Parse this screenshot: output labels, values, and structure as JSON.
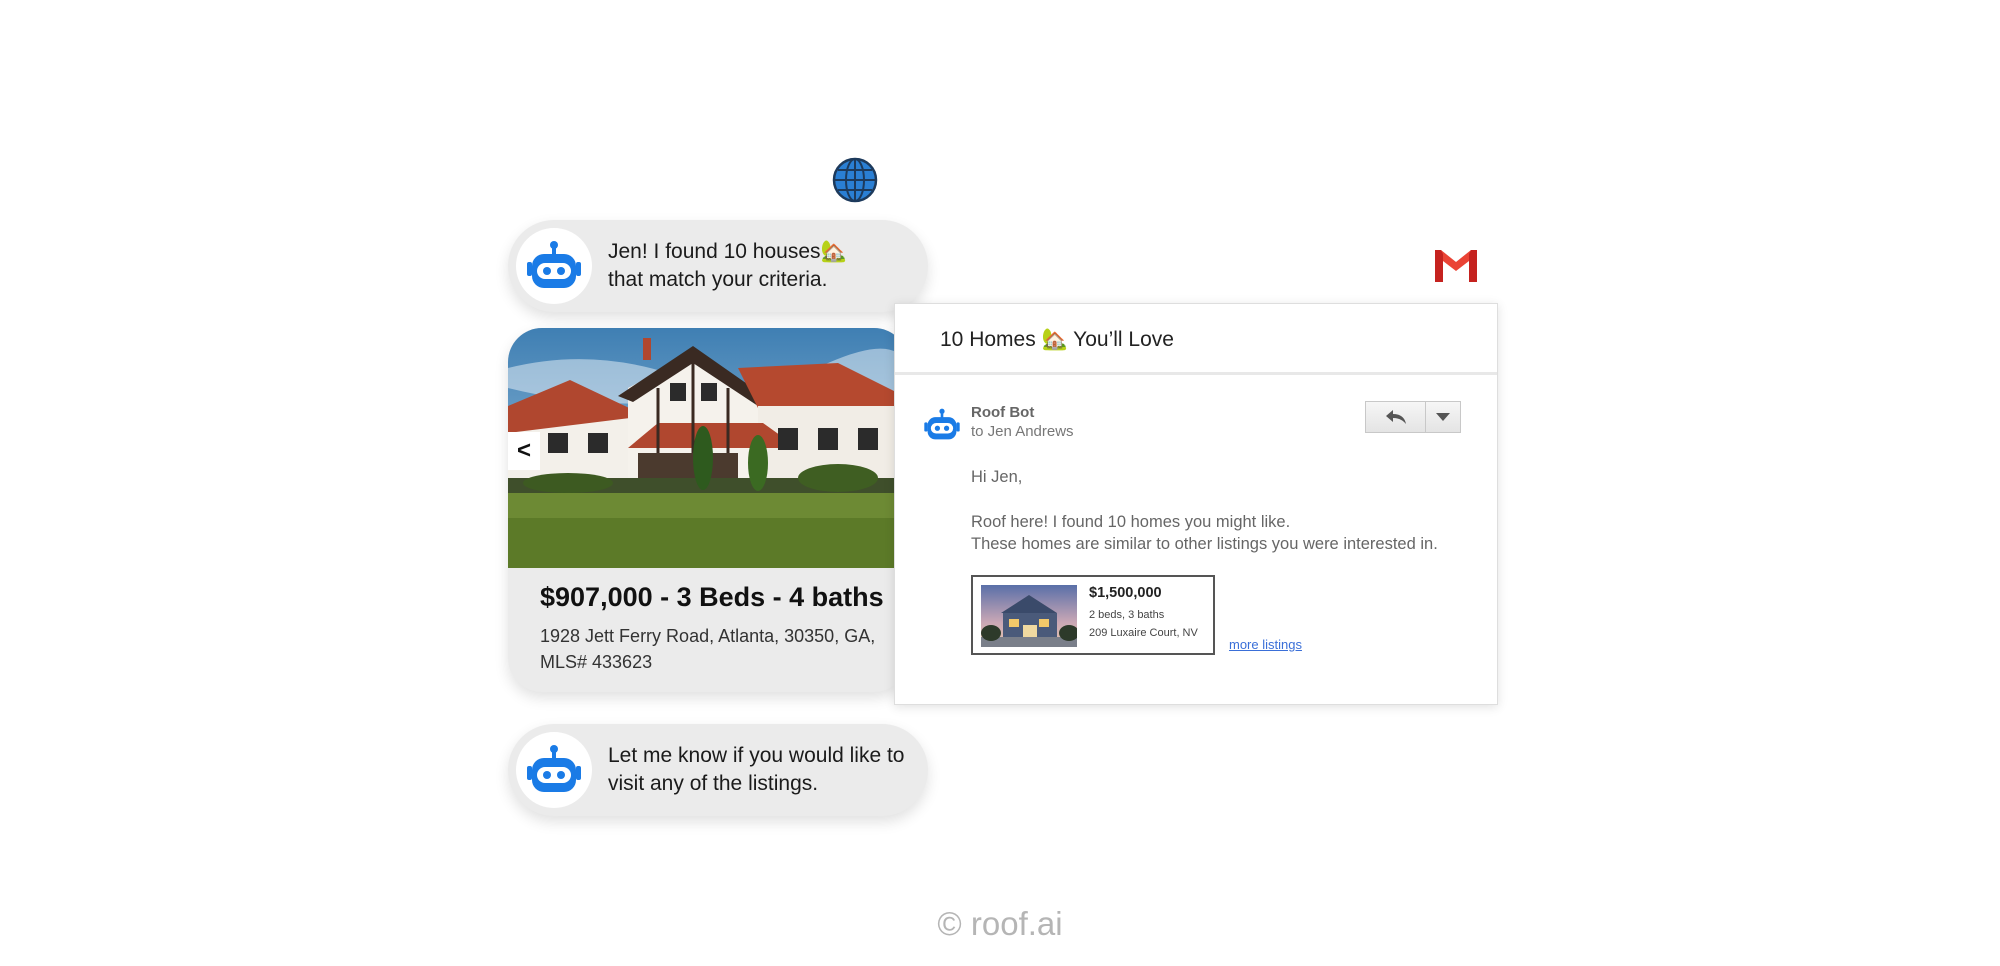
{
  "chat": {
    "message1": {
      "line1": "Jen! I found 10 houses🏡",
      "line2": "that match your criteria."
    },
    "listing": {
      "title": "$907,000 - 3 Beds - 4 baths",
      "address": "1928 Jett Ferry Road, Atlanta, 30350, GA,",
      "mls": "MLS# 433623",
      "prev_label": "<"
    },
    "message2": {
      "line1": "Let me know if you would like to",
      "line2": "visit any of the listings."
    },
    "bot_icon": "robot-icon",
    "globe_icon": "globe-icon"
  },
  "email": {
    "subject": "10 Homes 🏡 You’ll Love",
    "sender": "Roof Bot",
    "to": "to Jen Andrews",
    "greeting": "Hi Jen,",
    "body_line1": "Roof here! I found 10 homes you might like.",
    "body_line2": "These homes are similar to other listings you were interested in.",
    "listing": {
      "price": "$1,500,000",
      "beds_baths": "2 beds, 3 baths",
      "address": "209 Luxaire Court, NV"
    },
    "more_link": "more listings",
    "gmail_icon": "gmail-icon"
  },
  "footer": {
    "copyright": "© roof.ai"
  },
  "colors": {
    "brand_blue": "#1a7be6",
    "gmail_red": "#ea4335"
  }
}
